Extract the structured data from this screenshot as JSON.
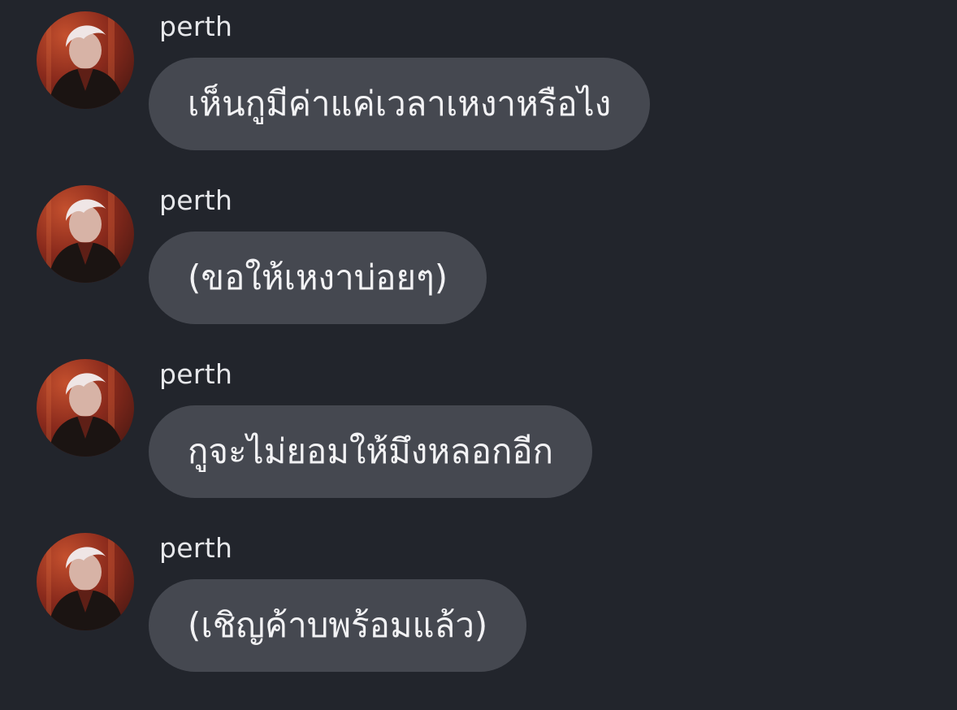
{
  "messages": [
    {
      "sender": "perth",
      "text": "เห็นกูมีค่าแค่เวลาเหงาหรือไง"
    },
    {
      "sender": "perth",
      "text": "(ขอให้เหงาบ่อยๆ)"
    },
    {
      "sender": "perth",
      "text": "กูจะไม่ยอมให้มึงหลอกอีก"
    },
    {
      "sender": "perth",
      "text": "(เชิญค้าบพร้อมแล้ว)"
    }
  ],
  "colors": {
    "background": "#22252c",
    "bubble": "#454850",
    "text": "#f2f2f4",
    "sender": "#e6e7ea"
  }
}
